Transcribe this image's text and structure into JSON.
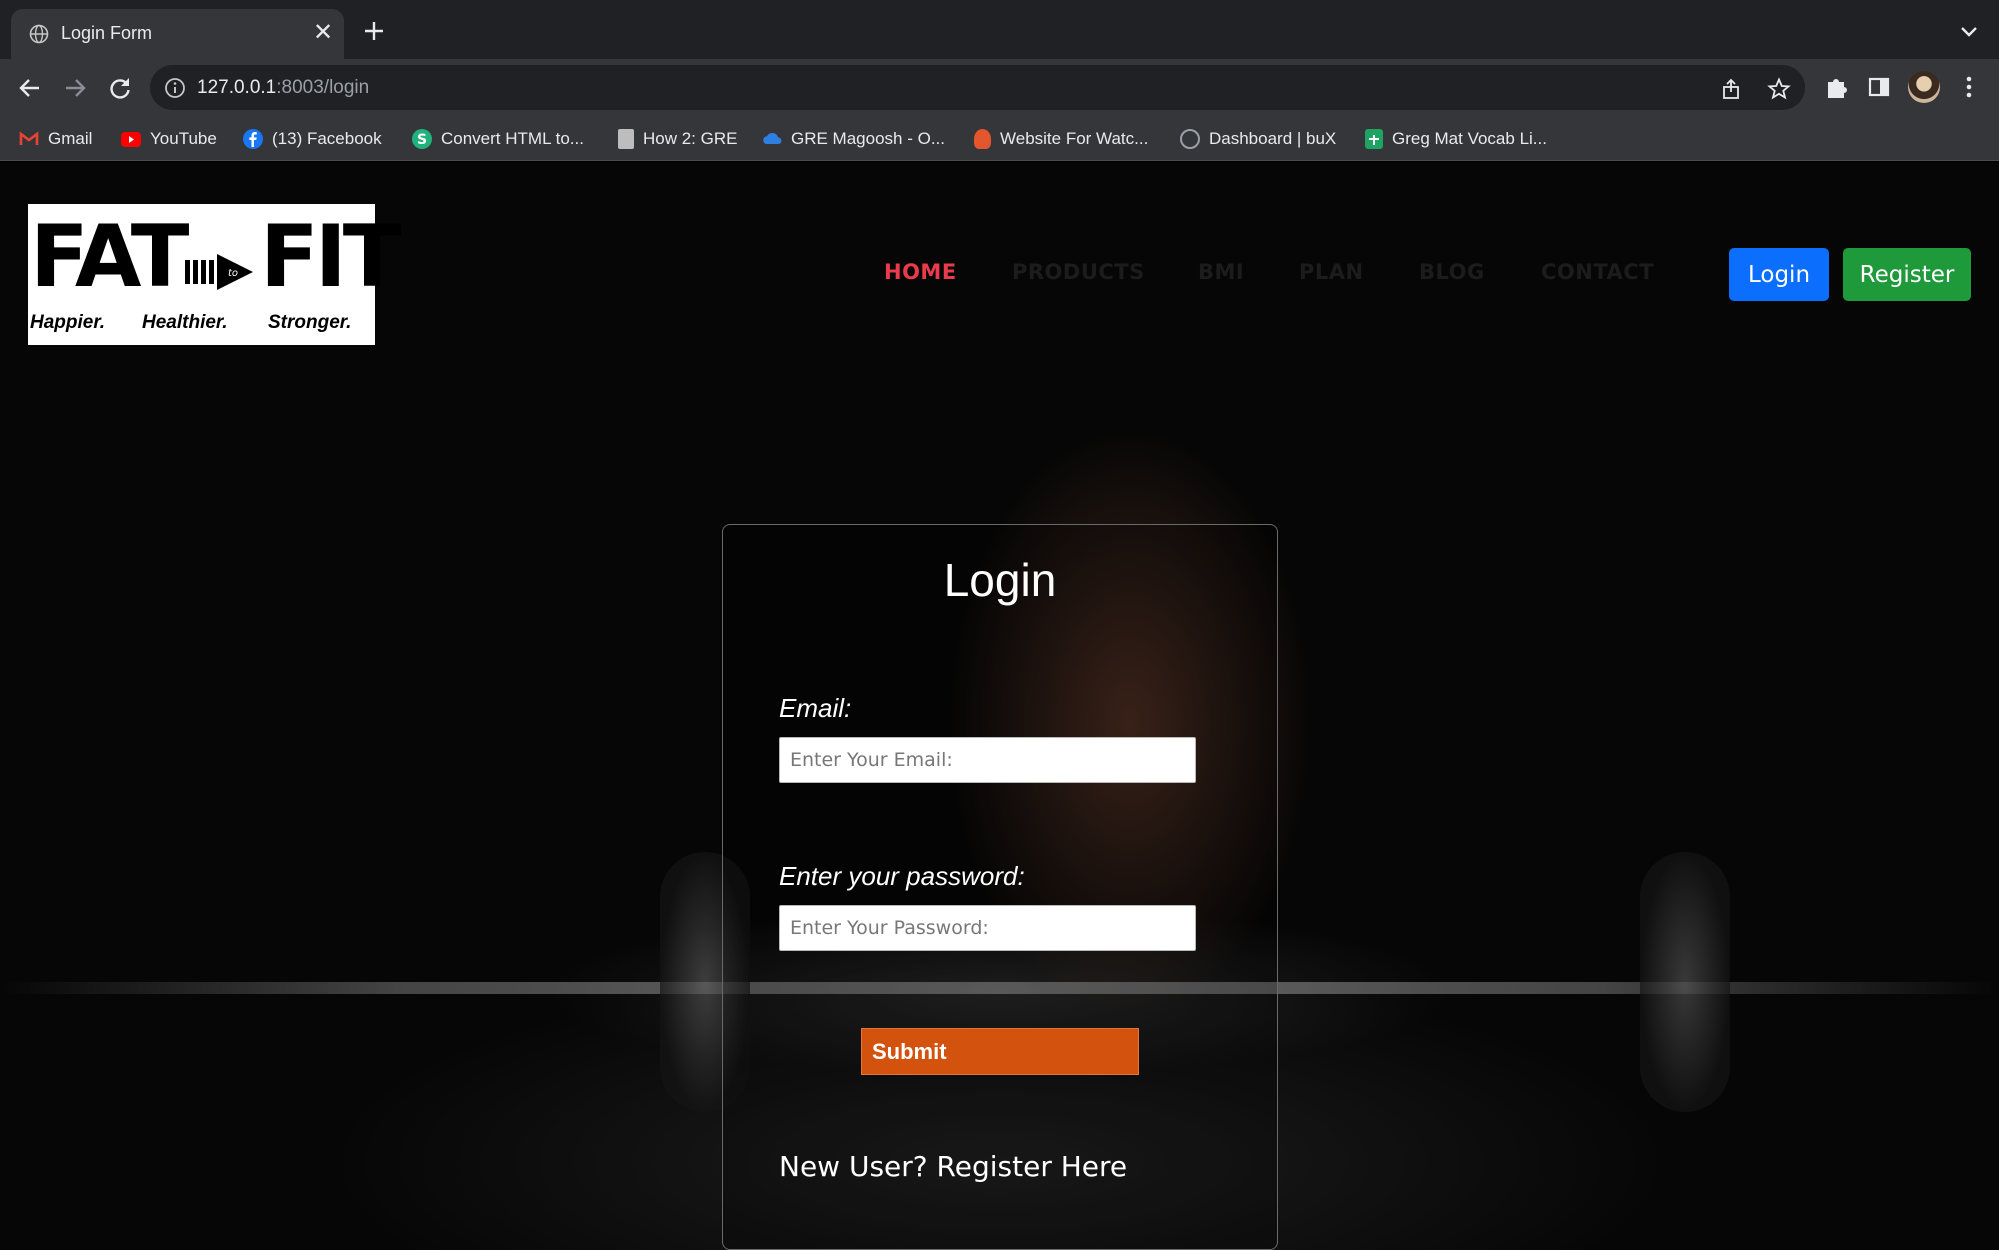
{
  "browser": {
    "tab_title": "Login Form",
    "close_glyph": "✕",
    "url_host": "127.0.0.1",
    "url_rest": ":8003/login",
    "bookmarks": [
      {
        "label": "Gmail",
        "icon": "gmail-icon",
        "color": "#ea4335"
      },
      {
        "label": "YouTube",
        "icon": "youtube-icon",
        "color": "#ff0000"
      },
      {
        "label": "(13) Facebook",
        "icon": "facebook-icon",
        "color": "#1877f2"
      },
      {
        "label": "Convert HTML to...",
        "icon": "convert-icon",
        "color": "#22b07d"
      },
      {
        "label": "How 2: GRE",
        "icon": "document-icon",
        "color": "#bdbdbd"
      },
      {
        "label": "GRE Magoosh - O...",
        "icon": "cloud-icon",
        "color": "#2f7fe0"
      },
      {
        "label": "Website For Watc...",
        "icon": "site-icon",
        "color": "#e4572e"
      },
      {
        "label": "Dashboard | buX",
        "icon": "dashboard-icon",
        "color": "#9aa0a6"
      },
      {
        "label": "Greg Mat Vocab Li...",
        "icon": "sheets-icon",
        "color": "#1ea362"
      }
    ]
  },
  "site": {
    "logo": {
      "word_left": "FAT",
      "arrow_text": "to",
      "word_right": "FIT",
      "tagline": [
        "Happier.",
        "Healthier.",
        "Stronger."
      ]
    },
    "nav": [
      {
        "label": "HOME",
        "active": true
      },
      {
        "label": "PRODUCTS",
        "active": false
      },
      {
        "label": "BMI",
        "active": false
      },
      {
        "label": "PLAN",
        "active": false
      },
      {
        "label": "BLOG",
        "active": false
      },
      {
        "label": "CONTACT",
        "active": false
      }
    ],
    "login_button": "Login",
    "register_button": "Register",
    "colors": {
      "active_nav": "#ea3b4c",
      "login_btn": "#0b6efd",
      "register_btn": "#1f9a3a",
      "submit_btn": "#d2520e"
    }
  },
  "form": {
    "title": "Login",
    "email_label": "Email:",
    "email_placeholder": "Enter Your Email:",
    "password_label": "Enter your password:",
    "password_placeholder": "Enter Your Password:",
    "submit_label": "Submit",
    "register_link": "New User? Register Here"
  }
}
